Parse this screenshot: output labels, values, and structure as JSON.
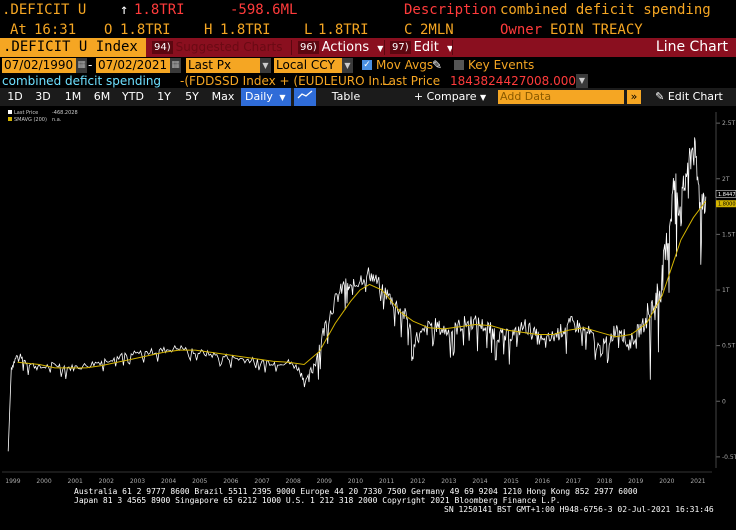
{
  "header": {
    "ticker": ".DEFICIT U",
    "arrow": "↑",
    "last": "1.8TRI",
    "change": "-598.6ML",
    "desc_label": "Description",
    "desc_value": "combined deficit spending",
    "at_label": "At",
    "time": "16:31",
    "o_label": "O",
    "o_value": "1.8TRI",
    "h_label": "H",
    "h_value": "1.8TRI",
    "l_label": "L",
    "l_value": "1.8TRI",
    "c_label": "C",
    "c_value": "2MLN",
    "owner_label": "Owner",
    "owner_value": "EOIN TREACY"
  },
  "command_bar": {
    "security": ".DEFICIT U Index",
    "suggested_num": "94)",
    "suggested_label": "Suggested Charts",
    "actions_num": "96)",
    "actions_label": "Actions",
    "edit_num": "97)",
    "edit_label": "Edit",
    "chart_type": "Line Chart"
  },
  "fields": {
    "start_date": "07/02/1990",
    "end_date": "07/02/2021",
    "price_field": "Last Px",
    "currency": "Local CCY",
    "mov_avgs_label": "Mov Avgs",
    "key_events_label": "Key Events",
    "series_name": "combined deficit spending",
    "formula": "-(FDDSSD Index + (EUDLEURO In...",
    "last_price_label": "Last Price",
    "last_price_value": "1843824427008.0000"
  },
  "toolbar": {
    "periods": [
      "1D",
      "3D",
      "1M",
      "6M",
      "YTD",
      "1Y",
      "5Y",
      "Max"
    ],
    "frequency": "Daily",
    "table_label": "Table",
    "compare_label": "Compare",
    "add_data_placeholder": "Add Data",
    "edit_chart_label": "Edit Chart"
  },
  "chart_data": {
    "type": "line",
    "legend": [
      {
        "name": "Last Price",
        "value": "-468.2028",
        "color": "#ffffff"
      },
      {
        "name": "SMAVG (200)",
        "value": "n.a.",
        "color": "#d4b400"
      }
    ],
    "legend_placement": "top-left",
    "x_ticks": [
      "1999",
      "2000",
      "2001",
      "2002",
      "2003",
      "2004",
      "2005",
      "2006",
      "2007",
      "2008",
      "2009",
      "2010",
      "2011",
      "2012",
      "2013",
      "2014",
      "2015",
      "2016",
      "2017",
      "2018",
      "2019",
      "2020",
      "2021"
    ],
    "y_ticks": [
      "2.5T",
      "2T",
      "1.5T",
      "1T",
      "0.5T",
      "0",
      "-0.5T"
    ],
    "ylim": [
      -0.6,
      2.6
    ],
    "last_price_tag": "1.8447",
    "sma_tag": "1.8000",
    "price_color": "#ffffff",
    "sma_color": "#d4b400",
    "grid": false,
    "series": [
      {
        "name": "Last Price",
        "x": [
          1999.0,
          1999.1,
          1999.3,
          1999.6,
          2000.0,
          2000.5,
          2001.0,
          2001.5,
          2002.0,
          2002.5,
          2003.0,
          2003.5,
          2004.0,
          2004.5,
          2005.0,
          2005.5,
          2006.0,
          2006.5,
          2007.0,
          2007.5,
          2008.0,
          2008.3,
          2008.6,
          2008.9,
          2009.2,
          2009.5,
          2009.8,
          2010.0,
          2010.3,
          2010.6,
          2010.9,
          2011.2,
          2011.5,
          2011.8,
          2012.0,
          2012.3,
          2012.6,
          2012.9,
          2013.2,
          2013.5,
          2013.8,
          2014.1,
          2014.4,
          2014.7,
          2015.0,
          2015.3,
          2015.6,
          2015.9,
          2016.2,
          2016.5,
          2016.8,
          2017.1,
          2017.4,
          2017.7,
          2018.0,
          2018.3,
          2018.6,
          2018.9,
          2019.2,
          2019.5,
          2019.8,
          2020.0,
          2020.2,
          2020.4,
          2020.6,
          2020.8,
          2021.0,
          2021.2,
          2021.4
        ],
        "y": [
          -0.45,
          0.3,
          0.42,
          0.35,
          0.3,
          0.33,
          0.3,
          0.32,
          0.36,
          0.4,
          0.42,
          0.44,
          0.46,
          0.48,
          0.45,
          0.42,
          0.4,
          0.38,
          0.36,
          0.35,
          0.35,
          0.3,
          0.15,
          0.4,
          0.7,
          0.9,
          1.05,
          1.0,
          1.1,
          1.15,
          1.05,
          0.95,
          0.85,
          0.75,
          0.55,
          0.6,
          0.7,
          0.65,
          0.62,
          0.68,
          0.72,
          0.7,
          0.66,
          0.6,
          0.58,
          0.62,
          0.68,
          0.6,
          0.52,
          0.58,
          0.64,
          0.7,
          0.66,
          0.6,
          0.46,
          0.55,
          0.7,
          0.5,
          0.62,
          0.72,
          0.9,
          1.1,
          1.5,
          2.0,
          1.7,
          2.1,
          2.3,
          1.85,
          1.84
        ]
      },
      {
        "name": "SMAVG (200)",
        "x": [
          1999.3,
          2000.0,
          2000.5,
          2001.0,
          2001.5,
          2002.0,
          2002.5,
          2003.0,
          2003.5,
          2004.0,
          2004.5,
          2005.0,
          2005.5,
          2006.0,
          2006.5,
          2007.0,
          2007.5,
          2008.0,
          2008.5,
          2009.0,
          2009.5,
          2010.0,
          2010.3,
          2010.6,
          2011.0,
          2011.3,
          2011.6,
          2012.0,
          2012.5,
          2013.0,
          2013.5,
          2014.0,
          2014.5,
          2015.0,
          2015.5,
          2016.0,
          2016.5,
          2017.0,
          2017.5,
          2018.0,
          2018.5,
          2019.0,
          2019.5,
          2020.0,
          2020.3,
          2020.6,
          2021.0,
          2021.4
        ],
        "y": [
          0.35,
          0.33,
          0.3,
          0.3,
          0.3,
          0.32,
          0.35,
          0.38,
          0.41,
          0.44,
          0.46,
          0.46,
          0.44,
          0.42,
          0.4,
          0.38,
          0.36,
          0.35,
          0.33,
          0.45,
          0.7,
          0.9,
          1.0,
          1.05,
          1.0,
          0.9,
          0.8,
          0.72,
          0.66,
          0.65,
          0.67,
          0.69,
          0.68,
          0.64,
          0.62,
          0.6,
          0.6,
          0.64,
          0.66,
          0.62,
          0.58,
          0.6,
          0.7,
          0.95,
          1.2,
          1.45,
          1.65,
          1.8
        ]
      }
    ]
  },
  "footer": {
    "line1": "Australia 61 2 9777 8600 Brazil 5511 2395 9000 Europe 44 20 7330 7500 Germany 49 69 9204 1210 Hong Kong 852 2977 6000",
    "line2": "Japan 81 3 4565 8900       Singapore 65 6212 1000       U.S. 1 212 318 2000             Copyright 2021 Bloomberg Finance L.P.",
    "line3": "SN 1250141 BST  GMT+1:00 H948-6756-3 02-Jul-2021 16:31:46"
  }
}
